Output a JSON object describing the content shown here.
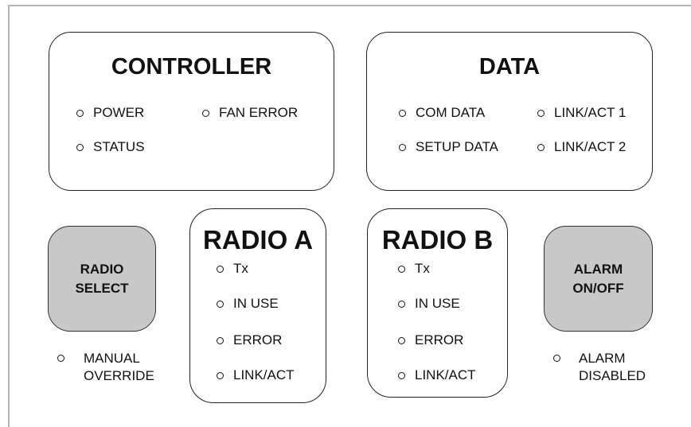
{
  "controller": {
    "title": "CONTROLLER",
    "leds": {
      "power": "POWER",
      "fan_error": "FAN ERROR",
      "status": "STATUS"
    }
  },
  "data_panel": {
    "title": "DATA",
    "leds": {
      "com_data": "COM DATA",
      "link_act_1": "LINK/ACT 1",
      "setup_data": "SETUP DATA",
      "link_act_2": "LINK/ACT 2"
    }
  },
  "radio_select": {
    "line1": "RADIO",
    "line2": "SELECT",
    "indicator_line1": "MANUAL",
    "indicator_line2": "OVERRIDE"
  },
  "radio_a": {
    "title": "RADIO A",
    "leds": {
      "tx": "Tx",
      "in_use": "IN USE",
      "error": "ERROR",
      "link_act": "LINK/ACT"
    }
  },
  "radio_b": {
    "title": "RADIO B",
    "leds": {
      "tx": "Tx",
      "in_use": "IN USE",
      "error": "ERROR",
      "link_act": "LINK/ACT"
    }
  },
  "alarm": {
    "line1": "ALARM",
    "line2": "ON/OFF",
    "indicator_line1": "ALARM",
    "indicator_line2": "DISABLED"
  },
  "colors": {
    "button_fill": "#c8c8c8",
    "outline": "#222222",
    "frame": "#b3b3b3"
  }
}
